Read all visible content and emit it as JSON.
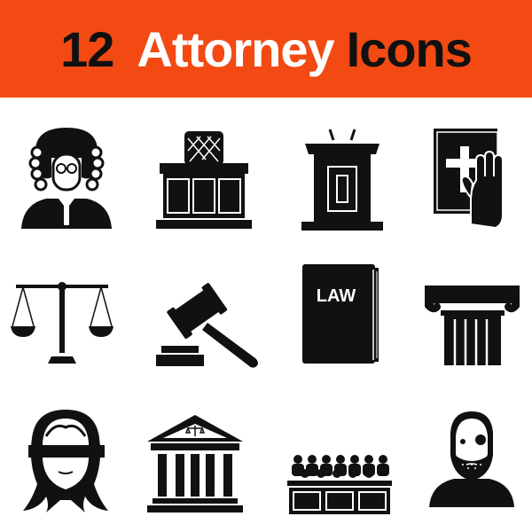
{
  "header": {
    "number": "12",
    "word_primary": "Attorney",
    "word_secondary": "Icons",
    "colors": {
      "banner": "#f24a12",
      "text_dark": "#111111",
      "text_light": "#ffffff"
    }
  },
  "icons": [
    {
      "name": "judge-icon"
    },
    {
      "name": "judge-bench-icon"
    },
    {
      "name": "podium-icon"
    },
    {
      "name": "oath-bible-icon"
    },
    {
      "name": "scales-icon"
    },
    {
      "name": "gavel-icon"
    },
    {
      "name": "law-book-icon",
      "label": "LAW"
    },
    {
      "name": "column-icon"
    },
    {
      "name": "lady-justice-icon"
    },
    {
      "name": "courthouse-icon"
    },
    {
      "name": "jury-icon"
    },
    {
      "name": "criminal-icon"
    }
  ],
  "colors": {
    "icon": "#111111",
    "background": "#ffffff"
  }
}
